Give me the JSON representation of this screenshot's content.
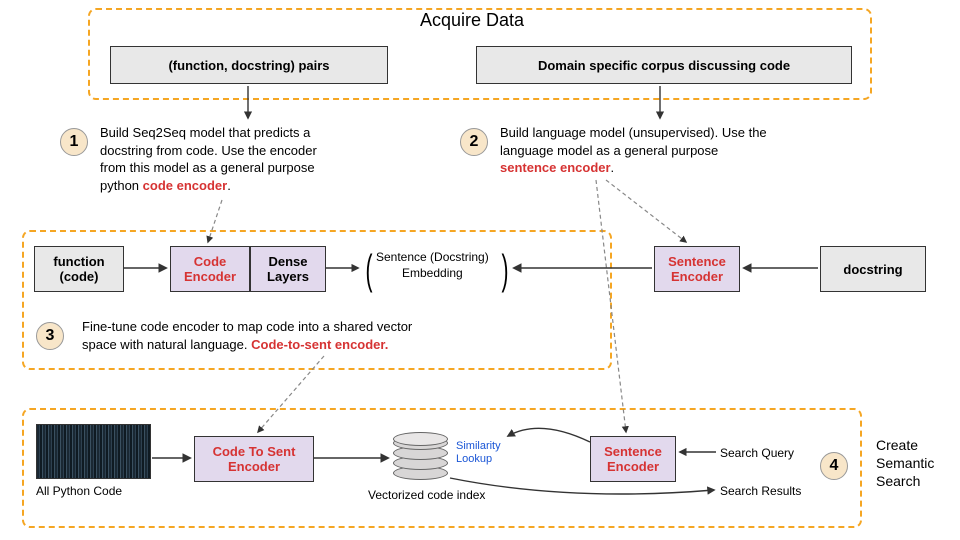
{
  "title": "Acquire Data",
  "top_boxes": {
    "left": "(function, docstring) pairs",
    "right": "Domain specific corpus discussing code"
  },
  "step1": {
    "num": "1",
    "text_a": "Build Seq2Seq model that predicts a",
    "text_b": "docstring from code. Use the encoder",
    "text_c": "from this model as a general purpose",
    "text_d": "python ",
    "text_e": "code encoder",
    "text_f": "."
  },
  "step2": {
    "num": "2",
    "text_a": "Build language model (unsupervised).  Use the",
    "text_b": "language model as a general purpose",
    "text_c": "sentence encoder",
    "text_d": "."
  },
  "mid": {
    "func": "function\n(code)",
    "code_enc": "Code\nEncoder",
    "dense": "Dense\nLayers",
    "embed_a": "Sentence (Docstring)",
    "embed_b": "Embedding",
    "sent_enc": "Sentence\nEncoder",
    "docstring": "docstring"
  },
  "step3": {
    "num": "3",
    "text_a": "Fine-tune code encoder to map code into a shared vector",
    "text_b": "space with natural language.  ",
    "text_c": "Code-to-sent encoder."
  },
  "bottom": {
    "code_label": "All Python Code",
    "cts": "Code To Sent\nEncoder",
    "db_label": "Vectorized code index",
    "sim": "Similarity\nLookup",
    "sent_enc2": "Sentence\nEncoder",
    "query": "Search Query",
    "results": "Search Results"
  },
  "step4": {
    "num": "4",
    "right_a": "Create",
    "right_b": "Semantic",
    "right_c": "Search"
  }
}
